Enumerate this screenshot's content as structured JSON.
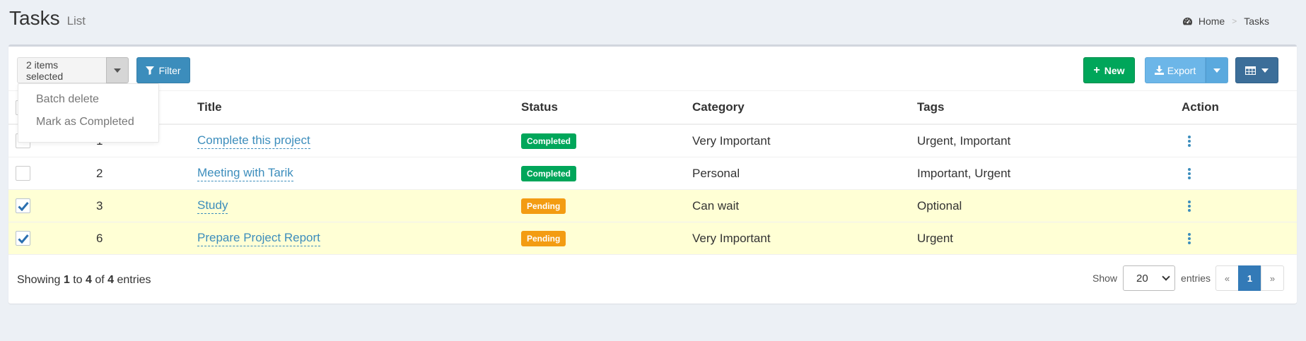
{
  "header": {
    "title": "Tasks",
    "subtitle": "List"
  },
  "breadcrumb": {
    "home_label": "Home",
    "separator": ">",
    "current_label": "Tasks",
    "home_icon": "dashboard-icon"
  },
  "toolbar": {
    "selector_label": "2 items selected",
    "filter_label": "Filter",
    "new_label": "New",
    "export_label": "Export",
    "columns_icon": "table-icon"
  },
  "batch_menu": {
    "items": [
      "Batch delete",
      "Mark as Completed"
    ]
  },
  "table": {
    "columns": [
      "Title",
      "Status",
      "Category",
      "Tags",
      "Action"
    ],
    "rows": [
      {
        "id": "1",
        "title": "Complete this project",
        "status": "Completed",
        "category": "Very Important",
        "tags": "Urgent, Important",
        "checked": false
      },
      {
        "id": "2",
        "title": "Meeting with Tarik",
        "status": "Completed",
        "category": "Personal",
        "tags": "Important, Urgent",
        "checked": false
      },
      {
        "id": "3",
        "title": "Study",
        "status": "Pending",
        "category": "Can wait",
        "tags": "Optional",
        "checked": true
      },
      {
        "id": "6",
        "title": "Prepare Project Report",
        "status": "Pending",
        "category": "Very Important",
        "tags": "Urgent",
        "checked": true
      }
    ]
  },
  "footer": {
    "showing_prefix": "Showing",
    "from": "1",
    "to_word": "to",
    "to": "4",
    "of_word": "of",
    "total": "4",
    "entries_word": "entries",
    "show_label": "Show",
    "per_page": "20",
    "entries_label": "entries",
    "pager": {
      "prev": "«",
      "current": "1",
      "next": "»"
    }
  },
  "colors": {
    "primary": "#3c8dbc",
    "success": "#00a65a",
    "warning": "#f39c12",
    "selected_row": "#ffffd5"
  }
}
